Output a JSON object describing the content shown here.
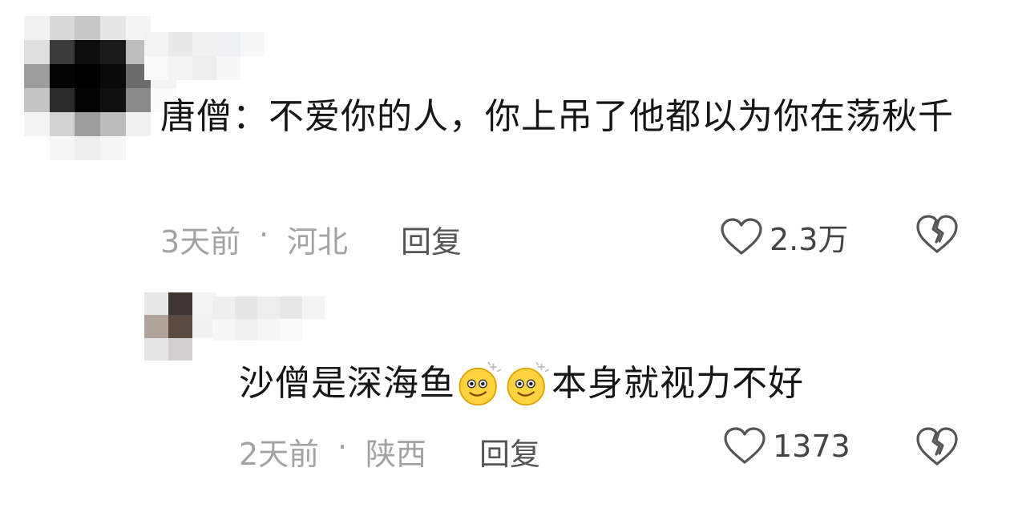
{
  "comments": [
    {
      "text": "唐僧：不爱你的人，你上吊了他都以为你在荡秋千",
      "time": "3天前",
      "separator": "·",
      "location": "河北",
      "reply_label": "回复",
      "likes": "2.3万",
      "avatar_mosaic": [
        "#f2f2f2",
        "#d9d9d9",
        "#c8c8c8",
        "#e6e6e6",
        "#f5f5f5",
        "#ffffff",
        "#e0e0e0",
        "#3a3a3a",
        "#0d0d0d",
        "#1a1a1a",
        "#bdbdbd",
        "#f8f8f8",
        "#9e9e9e",
        "#050505",
        "#000000",
        "#0a0a0a",
        "#6b6b6b",
        "#f4f4f4",
        "#c4c4c4",
        "#2b2b2b",
        "#030303",
        "#101010",
        "#8a8a8a",
        "#fafafa",
        "#f3f3f3",
        "#d2d2d2",
        "#9c9c9c",
        "#bcbcbc",
        "#f0f0f0",
        "#ffffff",
        "#ffffff",
        "#f6f6f6",
        "#eeeeee",
        "#f6f6f6",
        "#ffffff",
        "#ffffff"
      ],
      "name_mosaic": [
        "#f3f3f3",
        "#e9e9e9",
        "#f1f1f1",
        "#eef1f3",
        "#f7f7f7",
        "#fafafa",
        "#f4f4f4",
        "#ededed",
        "#f7f7f7",
        "#ffffff"
      ]
    },
    {
      "text_before_emoji": "沙僧是深海鱼",
      "text_after_emoji": "本身就视力不好",
      "emoji_name": "smiling-sparkle-emoji",
      "time": "2天前",
      "separator": "·",
      "location": "陕西",
      "reply_label": "回复",
      "likes": "1373",
      "avatar_mosaic": [
        "#e9e9e9",
        "#3d3532",
        "#f4f4f4",
        "#b0a39c",
        "#5b4a40",
        "#f1f1f1",
        "#e6e6e6",
        "#d4d0cd",
        "#ffffff"
      ],
      "name_mosaic": [
        "#efefef",
        "#e6e6e6",
        "#ededed",
        "#e7e7e7",
        "#f4f4f4",
        "#f7f7f7",
        "#f1f1f1",
        "#f6f6f6",
        "#fafafa",
        "#ffffff"
      ]
    }
  ],
  "colors": {
    "text": "#161616",
    "meta": "#a3a3a3",
    "icon": "#555555",
    "emoji_face": "#ffd23f",
    "emoji_edge": "#e0a000"
  },
  "icons": {
    "like": "heart-outline-icon",
    "dislike": "broken-heart-icon"
  }
}
